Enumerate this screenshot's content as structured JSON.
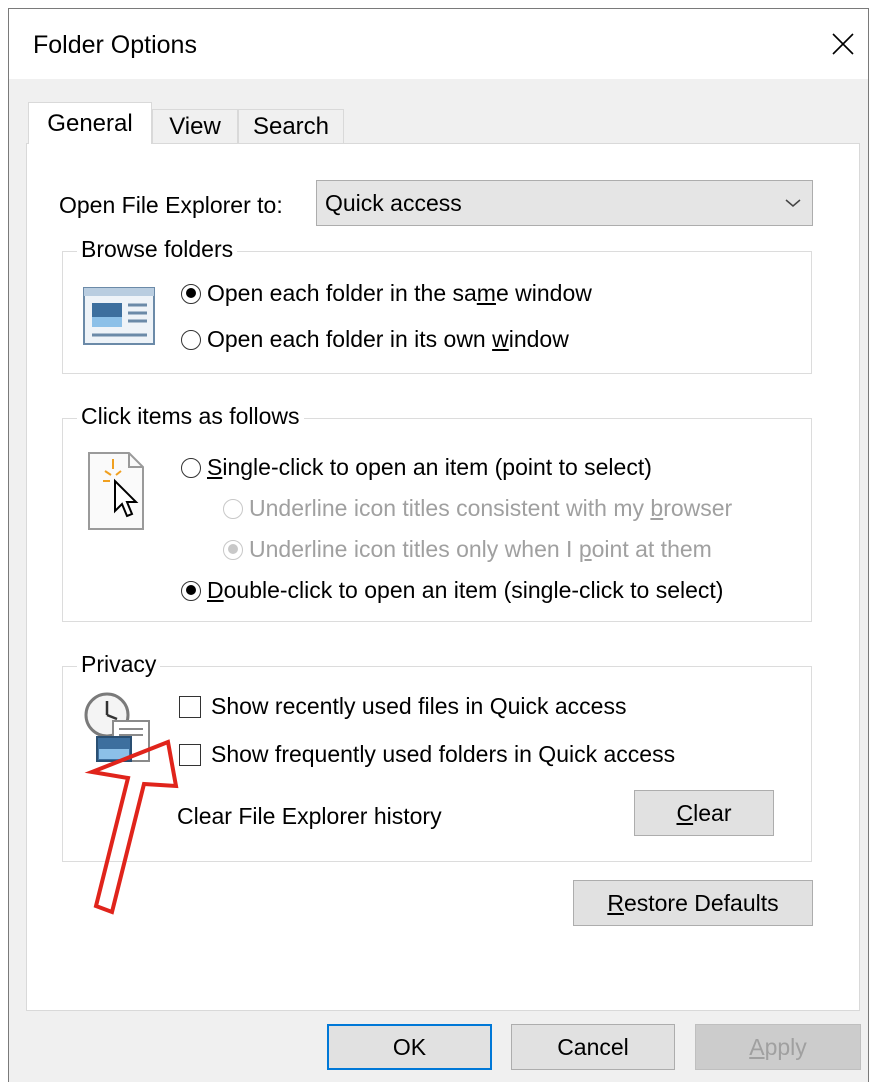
{
  "window": {
    "title": "Folder Options"
  },
  "tabs": [
    {
      "label": "General",
      "active": true
    },
    {
      "label": "View",
      "active": false
    },
    {
      "label": "Search",
      "active": false
    }
  ],
  "open_to": {
    "label": "Open File Explorer to:",
    "value": "Quick access"
  },
  "browse_folders": {
    "title": "Browse folders",
    "options": [
      {
        "pre": "Open each folder in the sa",
        "key": "m",
        "post": "e window",
        "checked": true
      },
      {
        "pre": "Open each folder in its own ",
        "key": "w",
        "post": "indow",
        "checked": false
      }
    ]
  },
  "click_items": {
    "title": "Click items as follows",
    "single_click": {
      "pre": "",
      "key": "S",
      "post": "ingle-click to open an item (point to select)",
      "checked": false
    },
    "underline_browser": {
      "pre": "Underline icon titles consistent with my ",
      "key": "b",
      "post": "rowser",
      "checked": false,
      "disabled": true
    },
    "underline_point": {
      "pre": "Underline icon titles only when I ",
      "key": "p",
      "post": "oint at them",
      "checked": true,
      "disabled": true
    },
    "double_click": {
      "pre": "",
      "key": "D",
      "post": "ouble-click to open an item (single-click to select)",
      "checked": true
    }
  },
  "privacy": {
    "title": "Privacy",
    "recent_files": {
      "label": "Show recently used files in Quick access",
      "checked": false
    },
    "frequent_folders": {
      "label": "Show frequently used folders in Quick access",
      "checked": false
    },
    "clear_history_label": "Clear File Explorer history",
    "clear_button": {
      "key": "C",
      "rest": "lear"
    }
  },
  "restore_defaults": {
    "key": "R",
    "rest": "estore Defaults"
  },
  "footer": {
    "ok": "OK",
    "cancel": "Cancel",
    "apply": {
      "key": "A",
      "rest": "pply"
    }
  },
  "colors": {
    "annotation_arrow": "#e0241b",
    "default_button_border": "#0078d7"
  }
}
